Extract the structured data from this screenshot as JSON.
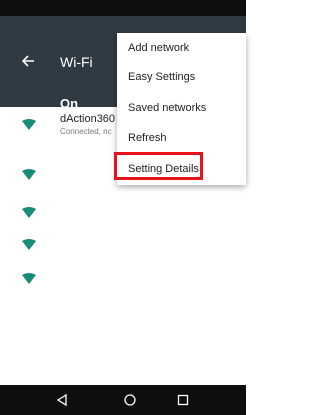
{
  "app_bar": {
    "title": "Wi-Fi",
    "toggle_label": "On",
    "color": "#2f3b44"
  },
  "networks": [
    {
      "name": "dAction360",
      "status": "Connected, nc"
    }
  ],
  "menu": {
    "items": [
      {
        "label": "Add network"
      },
      {
        "label": "Easy Settings"
      },
      {
        "label": "Saved networks"
      },
      {
        "label": "Refresh"
      },
      {
        "label": "Setting Details"
      }
    ],
    "highlight_color": "#e8121b"
  },
  "icons": {
    "back": "arrow-back-icon",
    "wifi": "wifi-icon",
    "nav_back": "triangle-back-icon",
    "nav_home": "circle-home-icon",
    "nav_recents": "square-recents-icon"
  },
  "accent": "#1a8c7c"
}
